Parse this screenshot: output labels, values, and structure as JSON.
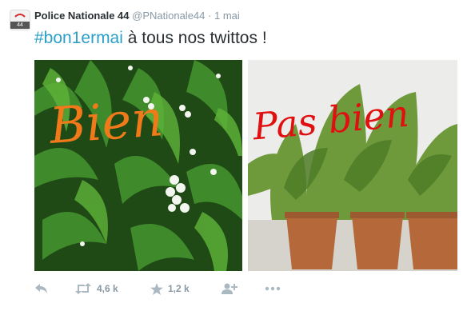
{
  "tweet": {
    "author_name": "Police Nationale 44",
    "handle": "@PNationale44",
    "separator": "·",
    "time": "1 mai",
    "avatar_number": "44",
    "hashtag": "#bon1ermai",
    "text": " à tous nos twittos !",
    "image_left_caption": "Bien",
    "image_right_caption": "Pas bien",
    "retweet_count": "4,6 k",
    "favorite_count": "1,2 k"
  },
  "colors": {
    "hashtag": "#2b9fc8",
    "caption_left": "#f07a1a",
    "caption_right": "#e01010"
  }
}
